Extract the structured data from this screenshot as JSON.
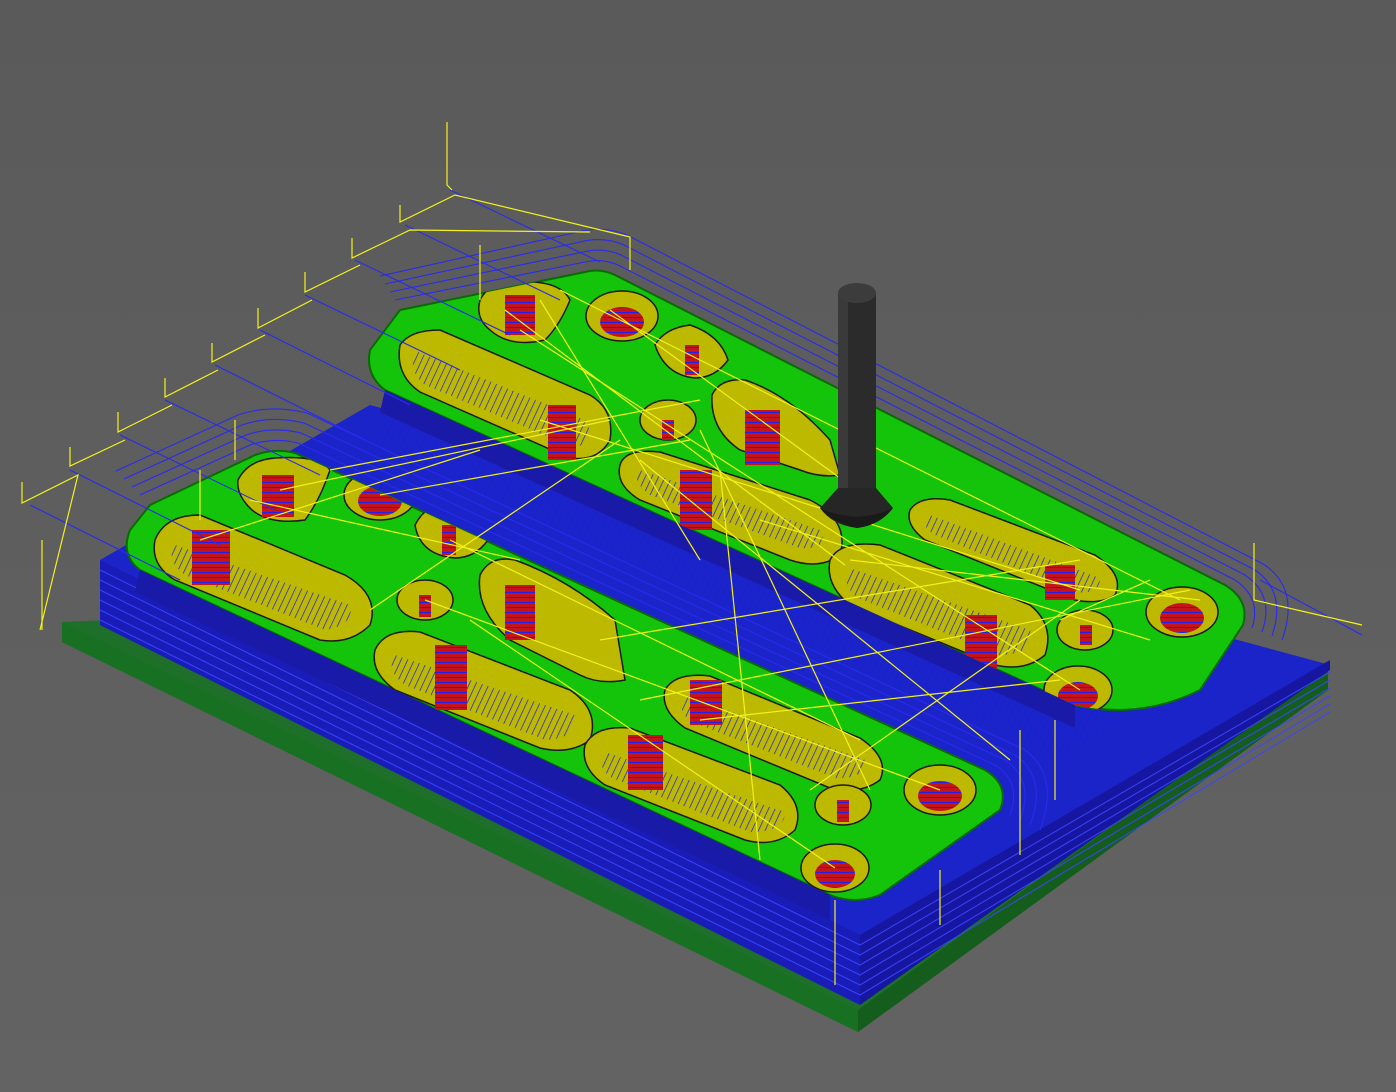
{
  "viewport": {
    "name": "cam-simulation-viewport",
    "view": "isometric",
    "background_color": "#5c5c5c"
  },
  "scene": {
    "stock_base_color": "#1f7a2c",
    "stock_side_color": "#1a22c8",
    "top_surface_color": "#14c40a",
    "pocket_wall_color": "#c9c400",
    "pocket_floor_color": "#9f9a00",
    "hole_floor_color": "#c81414",
    "cutting_toolpath_color": "#2a2af0",
    "rapid_move_color": "#f2f21a",
    "tool_color": "#2a2a2a",
    "parts": [
      {
        "name": "upper-plate",
        "pockets": 6,
        "holes": 7
      },
      {
        "name": "lower-plate",
        "pockets": 6,
        "holes": 7
      }
    ],
    "tool": {
      "name": "end-mill-tool",
      "icon": "tool-icon"
    }
  }
}
